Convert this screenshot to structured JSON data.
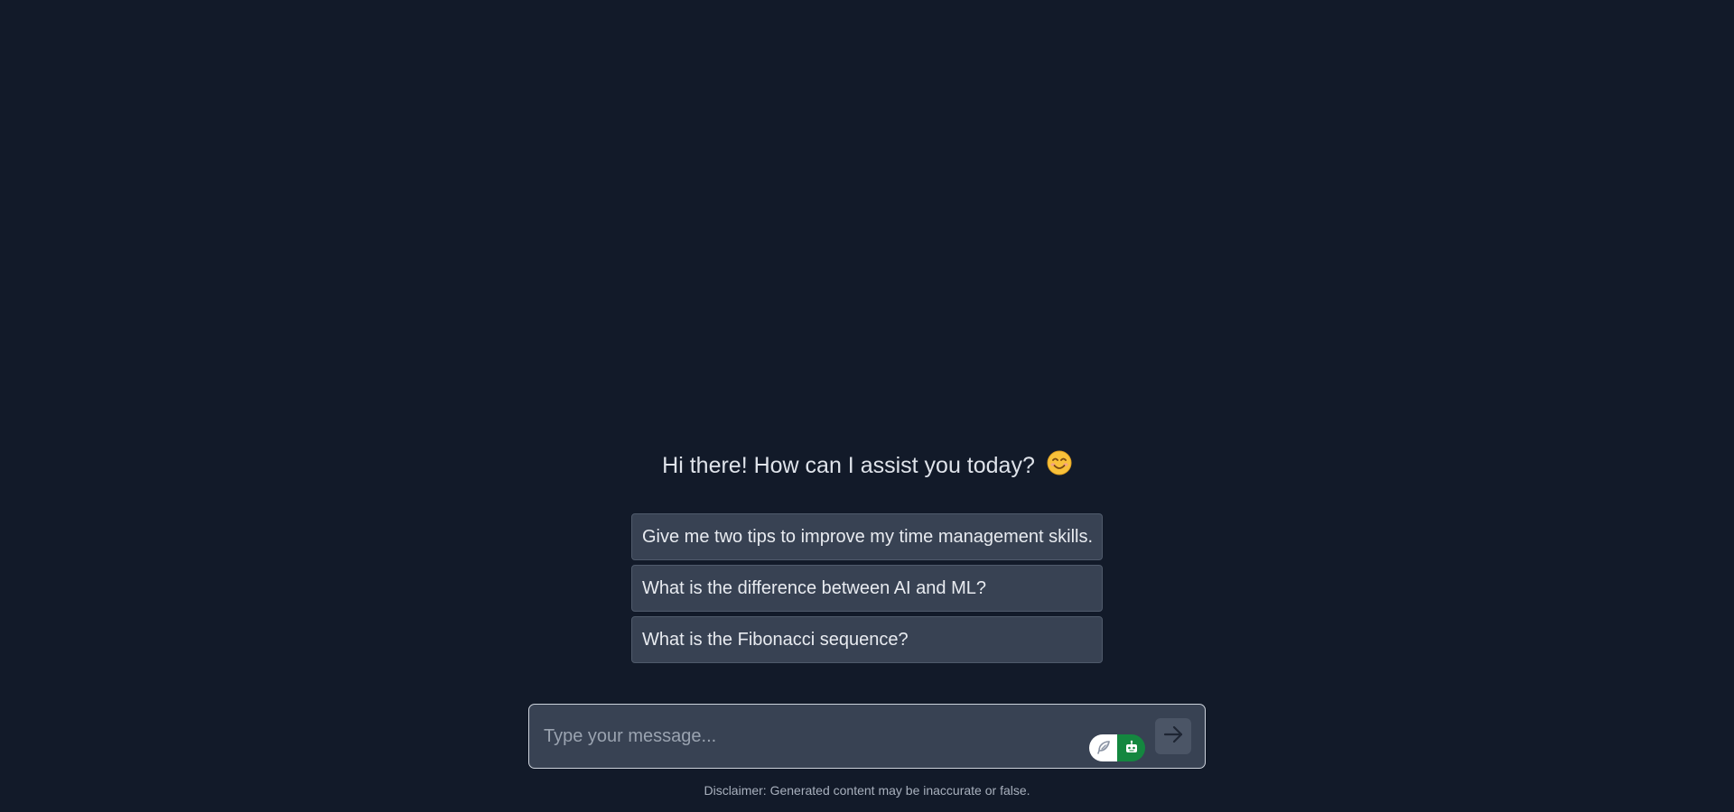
{
  "greeting": {
    "text": "Hi there! How can I assist you today?",
    "emoji": "😊"
  },
  "suggestions": [
    {
      "label": "Give me two tips to improve my time management skills."
    },
    {
      "label": "What is the difference between AI and ML?"
    },
    {
      "label": "What is the Fibonacci sequence?"
    }
  ],
  "composer": {
    "placeholder": "Type your message...",
    "mode_toggle_icons": [
      "feather-icon",
      "robot-icon"
    ],
    "send_icon": "arrow-right-icon"
  },
  "disclaimer": "Disclaimer: Generated content may be inaccurate or false.",
  "colors": {
    "background": "#121a29",
    "card": "#384253",
    "toggle_active": "#14873f"
  }
}
